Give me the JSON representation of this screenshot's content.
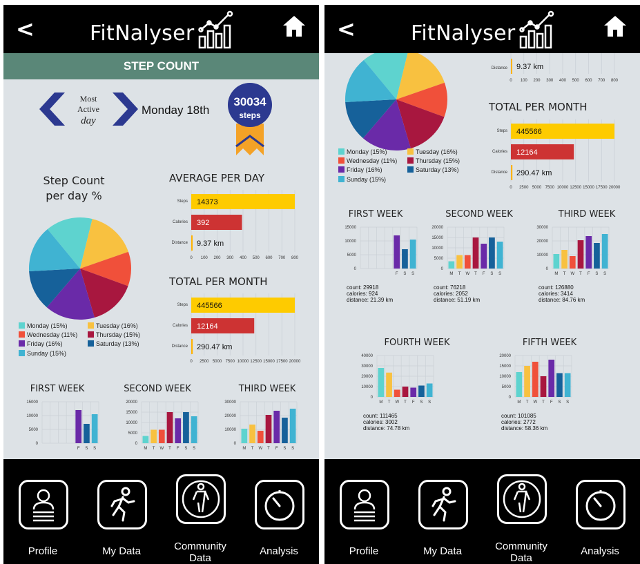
{
  "app": {
    "back_icon": "back-chevron-icon",
    "title": "FitNalyser",
    "logo_icon": "bar-chart-trend-icon",
    "home_icon": "home-icon"
  },
  "section_title": "STEP COUNT",
  "most_active": {
    "line1": "Most",
    "line2": "Active",
    "line3": "day",
    "day_text": "Monday 18th",
    "badge_value": "30034",
    "badge_unit": "steps"
  },
  "pie": {
    "title_line1": "Step Count",
    "title_line2": "per day %",
    "legend": [
      {
        "label": "Monday (15%)",
        "color": "#5ed3cf"
      },
      {
        "label": "Tuesday (16%)",
        "color": "#f8c140"
      },
      {
        "label": "Wednesday (11%)",
        "color": "#f0503a"
      },
      {
        "label": "Thursday (15%)",
        "color": "#a8173f"
      },
      {
        "label": "Friday (16%)",
        "color": "#6a2aa8"
      },
      {
        "label": "Saturday (13%)",
        "color": "#16619a"
      },
      {
        "label": "Sunday (15%)",
        "color": "#40b3d2"
      }
    ]
  },
  "bar_labels": {
    "steps": "Steps",
    "calories": "Calories",
    "distance": "Distance"
  },
  "chart_data": [
    {
      "type": "pie",
      "title": "Step Count per day %",
      "categories": [
        "Monday",
        "Tuesday",
        "Wednesday",
        "Thursday",
        "Friday",
        "Saturday",
        "Sunday"
      ],
      "values": [
        15,
        16,
        11,
        15,
        16,
        13,
        15
      ]
    },
    {
      "type": "bar",
      "orientation": "horizontal",
      "title": "AVERAGE PER DAY",
      "categories": [
        "Steps",
        "Calories",
        "Distance"
      ],
      "values": [
        14373,
        392,
        9.37
      ],
      "display_values": [
        800,
        392,
        9.37
      ],
      "data_labels": [
        "14373",
        "392",
        "9.37 km"
      ],
      "xlim": [
        0,
        800
      ],
      "ticks": [
        "0",
        "100",
        "200",
        "300",
        "400",
        "500",
        "600",
        "700",
        "800"
      ],
      "colors": [
        "#fecb00",
        "#cd3333",
        "#ffb300"
      ]
    },
    {
      "type": "bar",
      "orientation": "horizontal",
      "title": "TOTAL PER MONTH",
      "categories": [
        "Steps",
        "Calories",
        "Distance"
      ],
      "values": [
        445566,
        12164,
        290.47
      ],
      "display_values": [
        20000,
        12164,
        290.47
      ],
      "data_labels": [
        "445566",
        "12164",
        "290.47 km"
      ],
      "xlim": [
        0,
        20000
      ],
      "ticks": [
        "0",
        "2500",
        "5000",
        "7500",
        "10000",
        "12500",
        "15000",
        "17500",
        "20000"
      ],
      "colors": [
        "#fecb00",
        "#cd3333",
        "#ffb300"
      ]
    },
    {
      "type": "bar",
      "title": "FIRST WEEK",
      "categories": [
        "F",
        "S",
        "S"
      ],
      "values": [
        12000,
        7000,
        10500
      ],
      "ylim": [
        0,
        15000
      ],
      "yticks": [
        "0",
        "5000",
        "10000",
        "15000"
      ],
      "colors": [
        "#6a2aa8",
        "#16619a",
        "#40b3d2"
      ],
      "summary": [
        "count: 29918",
        "calories: 924",
        "distance: 21.39 km"
      ]
    },
    {
      "type": "bar",
      "title": "SECOND WEEK",
      "categories": [
        "M",
        "T",
        "W",
        "T",
        "F",
        "S",
        "S"
      ],
      "values": [
        3500,
        6500,
        6500,
        15000,
        12000,
        15000,
        13000
      ],
      "ylim": [
        0,
        20000
      ],
      "yticks": [
        "0",
        "5000",
        "10000",
        "15000",
        "20000"
      ],
      "colors": [
        "#5ed3cf",
        "#f8c140",
        "#f0503a",
        "#a8173f",
        "#6a2aa8",
        "#16619a",
        "#40b3d2"
      ],
      "summary": [
        "count: 76218",
        "calories: 2052",
        "distance: 51.19 km"
      ]
    },
    {
      "type": "bar",
      "title": "THIRD WEEK",
      "categories": [
        "M",
        "T",
        "W",
        "T",
        "F",
        "S",
        "S"
      ],
      "values": [
        10500,
        13500,
        9000,
        20500,
        23500,
        18500,
        25000
      ],
      "ylim": [
        0,
        30000
      ],
      "yticks": [
        "0",
        "10000",
        "20000",
        "30000"
      ],
      "colors": [
        "#5ed3cf",
        "#f8c140",
        "#f0503a",
        "#a8173f",
        "#6a2aa8",
        "#16619a",
        "#40b3d2"
      ],
      "summary": [
        "count: 126880",
        "calories: 3414",
        "distance: 84.76 km"
      ]
    },
    {
      "type": "bar",
      "title": "FOURTH WEEK",
      "categories": [
        "M",
        "T",
        "W",
        "T",
        "F",
        "S",
        "S"
      ],
      "values": [
        28000,
        23500,
        7000,
        10000,
        9000,
        11000,
        13000
      ],
      "ylim": [
        0,
        40000
      ],
      "yticks": [
        "0",
        "10000",
        "20000",
        "30000",
        "40000"
      ],
      "colors": [
        "#5ed3cf",
        "#f8c140",
        "#f0503a",
        "#a8173f",
        "#6a2aa8",
        "#16619a",
        "#40b3d2"
      ],
      "summary": [
        "count: 111465",
        "calories: 3002",
        "distance: 74.78 km"
      ]
    },
    {
      "type": "bar",
      "title": "FIFTH WEEK",
      "categories": [
        "M",
        "T",
        "W",
        "T",
        "F",
        "S",
        "S"
      ],
      "values": [
        12000,
        15000,
        17000,
        10000,
        18000,
        11500,
        11500
      ],
      "ylim": [
        0,
        20000
      ],
      "yticks": [
        "0",
        "5000",
        "10000",
        "15000",
        "20000"
      ],
      "colors": [
        "#5ed3cf",
        "#f8c140",
        "#f0503a",
        "#a8173f",
        "#6a2aa8",
        "#16619a",
        "#40b3d2"
      ],
      "summary": [
        "count: 101085",
        "calories: 2772",
        "distance: 58.36 km"
      ]
    }
  ],
  "nav": [
    {
      "label": "Profile",
      "icon": "profile-icon"
    },
    {
      "label": "My Data",
      "icon": "runner-icon"
    },
    {
      "label_line1": "Community",
      "label_line2": "Data",
      "icon": "community-person-icon"
    },
    {
      "label": "Analysis",
      "icon": "stopwatch-icon"
    }
  ]
}
